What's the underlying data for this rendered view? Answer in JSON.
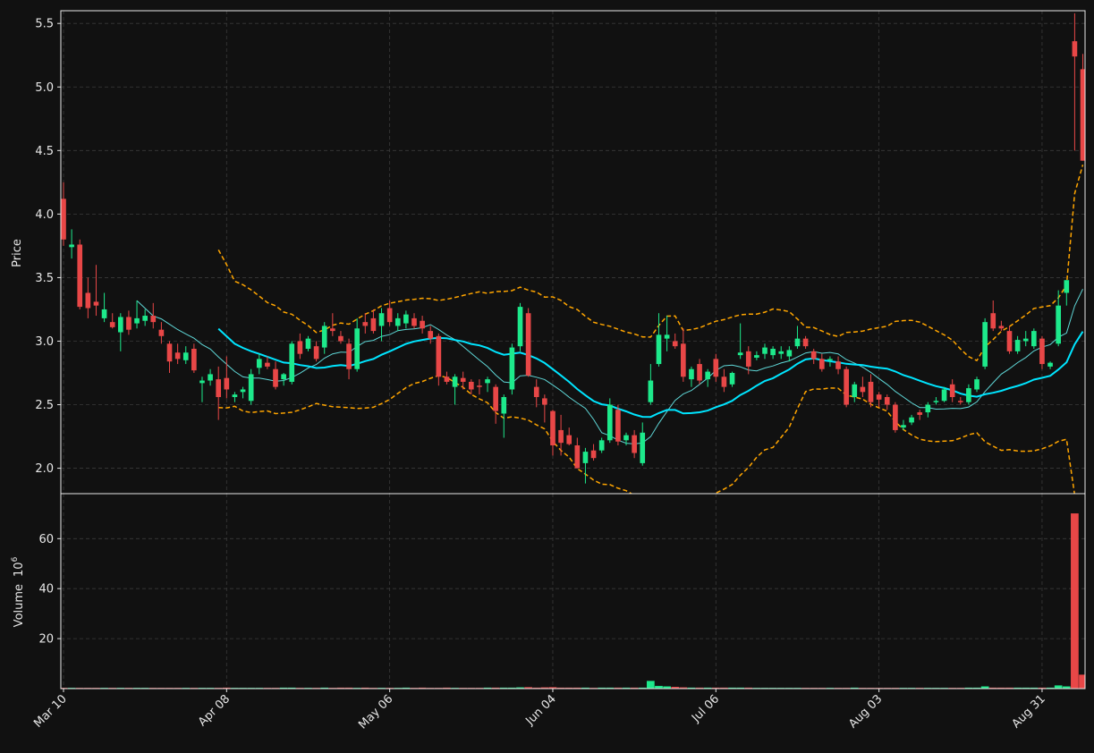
{
  "colors": {
    "background": "#111111",
    "up": "#1de98b",
    "down": "#e84747",
    "ma_fast": "#5fd7d7",
    "ma_slow": "#00e5ff",
    "band": "#ffa500",
    "grid": "#3a3a3a",
    "axis": "#e8e8e8"
  },
  "chart_data": {
    "type": "candlestick",
    "grid": true,
    "price_panel": {
      "ylabel": "Price",
      "ylim": [
        1.8,
        5.6
      ],
      "yticks": [
        "2.0",
        "2.5",
        "3.0",
        "3.5",
        "4.0",
        "4.5",
        "5.0",
        "5.5"
      ]
    },
    "volume_panel": {
      "ylabel": "Volume",
      "yunit": "10",
      "yunit_exp": "6",
      "ylim": [
        0,
        78
      ],
      "yticks": [
        "20",
        "40",
        "60"
      ]
    },
    "xticks": [
      {
        "label": "Mar 10",
        "index": 0
      },
      {
        "label": "Apr 08",
        "index": 20
      },
      {
        "label": "May 06",
        "index": 40
      },
      {
        "label": "Jun 04",
        "index": 60
      },
      {
        "label": "Jul 06",
        "index": 80
      },
      {
        "label": "Aug 03",
        "index": 100
      },
      {
        "label": "Aug 31",
        "index": 120
      }
    ],
    "candles": [
      [
        4.12,
        4.25,
        3.75,
        3.8,
        0.2
      ],
      [
        3.74,
        3.88,
        3.65,
        3.76,
        0.2
      ],
      [
        3.76,
        3.8,
        3.25,
        3.27,
        0.2
      ],
      [
        3.38,
        3.5,
        3.18,
        3.26,
        0.2
      ],
      [
        3.31,
        3.6,
        3.2,
        3.28,
        0.2
      ],
      [
        3.18,
        3.38,
        3.15,
        3.25,
        0.2
      ],
      [
        3.15,
        3.22,
        3.1,
        3.11,
        0.2
      ],
      [
        3.07,
        3.22,
        2.92,
        3.19,
        0.2
      ],
      [
        3.19,
        3.24,
        3.05,
        3.09,
        0.2
      ],
      [
        3.14,
        3.32,
        3.1,
        3.18,
        0.2
      ],
      [
        3.16,
        3.25,
        3.12,
        3.2,
        0.2
      ],
      [
        3.2,
        3.3,
        3.1,
        3.15,
        0.2
      ],
      [
        3.09,
        3.15,
        2.98,
        3.04,
        0.2
      ],
      [
        2.98,
        3.0,
        2.75,
        2.84,
        0.2
      ],
      [
        2.91,
        2.98,
        2.82,
        2.86,
        0.2
      ],
      [
        2.85,
        2.96,
        2.82,
        2.91,
        0.2
      ],
      [
        2.94,
        2.98,
        2.75,
        2.77,
        0.2
      ],
      [
        2.67,
        2.72,
        2.52,
        2.69,
        0.2
      ],
      [
        2.69,
        2.78,
        2.65,
        2.74,
        0.2
      ],
      [
        2.7,
        2.8,
        2.38,
        2.56,
        0.2
      ],
      [
        2.71,
        2.88,
        2.55,
        2.62,
        0.3
      ],
      [
        2.56,
        2.6,
        2.52,
        2.58,
        0.2
      ],
      [
        2.6,
        2.64,
        2.55,
        2.62,
        0.2
      ],
      [
        2.53,
        2.78,
        2.5,
        2.74,
        0.2
      ],
      [
        2.79,
        2.9,
        2.74,
        2.86,
        0.2
      ],
      [
        2.83,
        2.88,
        2.78,
        2.8,
        0.2
      ],
      [
        2.78,
        2.84,
        2.62,
        2.64,
        0.2
      ],
      [
        2.7,
        2.75,
        2.65,
        2.74,
        0.3
      ],
      [
        2.68,
        3.0,
        2.66,
        2.98,
        0.3
      ],
      [
        3.0,
        3.06,
        2.86,
        2.9,
        0.2
      ],
      [
        2.94,
        3.04,
        2.92,
        3.02,
        0.2
      ],
      [
        2.96,
        3.0,
        2.84,
        2.86,
        0.2
      ],
      [
        2.95,
        3.15,
        2.9,
        3.12,
        0.3
      ],
      [
        3.1,
        3.22,
        3.04,
        3.08,
        0.2
      ],
      [
        3.04,
        3.08,
        2.98,
        3.0,
        0.3
      ],
      [
        2.98,
        3.02,
        2.7,
        2.78,
        0.3
      ],
      [
        2.78,
        3.18,
        2.76,
        3.1,
        0.2
      ],
      [
        3.15,
        3.22,
        3.06,
        3.12,
        0.3
      ],
      [
        3.18,
        3.25,
        3.06,
        3.08,
        0.2
      ],
      [
        3.12,
        3.26,
        3.0,
        3.22,
        0.2
      ],
      [
        3.26,
        3.32,
        3.12,
        3.15,
        0.2
      ],
      [
        3.12,
        3.22,
        3.08,
        3.18,
        0.2
      ],
      [
        3.14,
        3.24,
        3.1,
        3.21,
        0.3
      ],
      [
        3.18,
        3.22,
        3.1,
        3.12,
        0.2
      ],
      [
        3.16,
        3.2,
        3.06,
        3.1,
        0.3
      ],
      [
        3.08,
        3.12,
        2.98,
        3.02,
        0.2
      ],
      [
        3.04,
        3.06,
        2.65,
        2.72,
        0.2
      ],
      [
        2.72,
        2.76,
        2.66,
        2.68,
        0.3
      ],
      [
        2.64,
        2.74,
        2.5,
        2.72,
        0.2
      ],
      [
        2.71,
        2.76,
        2.62,
        2.68,
        0.2
      ],
      [
        2.68,
        2.7,
        2.58,
        2.62,
        0.2
      ],
      [
        2.65,
        2.7,
        2.58,
        2.64,
        0.2
      ],
      [
        2.67,
        2.72,
        2.6,
        2.7,
        0.3
      ],
      [
        2.64,
        2.66,
        2.35,
        2.45,
        0.3
      ],
      [
        2.43,
        2.58,
        2.24,
        2.56,
        0.3
      ],
      [
        2.62,
        2.98,
        2.58,
        2.95,
        0.3
      ],
      [
        2.96,
        3.3,
        2.92,
        3.27,
        0.4
      ],
      [
        3.22,
        3.26,
        2.72,
        2.73,
        0.5
      ],
      [
        2.64,
        2.7,
        2.48,
        2.56,
        0.3
      ],
      [
        2.55,
        2.58,
        2.36,
        2.5,
        0.4
      ],
      [
        2.45,
        2.46,
        2.1,
        2.18,
        0.5
      ],
      [
        2.3,
        2.42,
        2.1,
        2.2,
        0.3
      ],
      [
        2.26,
        2.32,
        2.18,
        2.19,
        0.3
      ],
      [
        2.18,
        2.24,
        2.0,
        2.0,
        0.3
      ],
      [
        2.04,
        2.16,
        1.88,
        2.13,
        0.3
      ],
      [
        2.14,
        2.19,
        2.06,
        2.08,
        0.2
      ],
      [
        2.14,
        2.24,
        2.12,
        2.22,
        0.3
      ],
      [
        2.22,
        2.55,
        2.2,
        2.5,
        0.3
      ],
      [
        2.46,
        2.5,
        2.18,
        2.21,
        0.3
      ],
      [
        2.22,
        2.28,
        2.18,
        2.26,
        0.3
      ],
      [
        2.26,
        2.3,
        2.08,
        2.12,
        0.3
      ],
      [
        2.04,
        2.36,
        2.02,
        2.28,
        0.3
      ],
      [
        2.52,
        2.82,
        2.5,
        2.69,
        3.0
      ],
      [
        2.82,
        3.22,
        2.8,
        3.05,
        1.0
      ],
      [
        3.02,
        3.2,
        2.92,
        3.05,
        0.8
      ],
      [
        3.0,
        3.06,
        2.94,
        2.96,
        0.6
      ],
      [
        2.98,
        3.1,
        2.68,
        2.72,
        0.4
      ],
      [
        2.7,
        2.8,
        2.64,
        2.78,
        0.3
      ],
      [
        2.82,
        2.86,
        2.66,
        2.69,
        0.3
      ],
      [
        2.7,
        2.78,
        2.64,
        2.76,
        0.3
      ],
      [
        2.86,
        2.9,
        2.68,
        2.72,
        0.3
      ],
      [
        2.72,
        2.78,
        2.6,
        2.64,
        0.3
      ],
      [
        2.66,
        2.76,
        2.64,
        2.75,
        0.3
      ],
      [
        2.89,
        3.14,
        2.86,
        2.91,
        0.3
      ],
      [
        2.92,
        2.96,
        2.74,
        2.8,
        0.3
      ],
      [
        2.87,
        2.92,
        2.85,
        2.89,
        0.2
      ],
      [
        2.9,
        2.98,
        2.86,
        2.95,
        0.2
      ],
      [
        2.89,
        2.96,
        2.86,
        2.94,
        0.2
      ],
      [
        2.9,
        2.96,
        2.86,
        2.92,
        0.2
      ],
      [
        2.88,
        2.96,
        2.84,
        2.93,
        0.2
      ],
      [
        2.96,
        3.12,
        2.94,
        3.02,
        0.2
      ],
      [
        3.02,
        3.04,
        2.94,
        2.96,
        0.2
      ],
      [
        2.92,
        2.94,
        2.82,
        2.86,
        0.2
      ],
      [
        2.86,
        2.9,
        2.76,
        2.78,
        0.2
      ],
      [
        2.85,
        2.88,
        2.8,
        2.86,
        0.2
      ],
      [
        2.84,
        2.88,
        2.74,
        2.78,
        0.2
      ],
      [
        2.78,
        2.8,
        2.48,
        2.5,
        0.2
      ],
      [
        2.56,
        2.68,
        2.52,
        2.66,
        0.3
      ],
      [
        2.64,
        2.72,
        2.56,
        2.6,
        0.2
      ],
      [
        2.68,
        2.74,
        2.48,
        2.52,
        0.2
      ],
      [
        2.58,
        2.6,
        2.48,
        2.54,
        0.2
      ],
      [
        2.56,
        2.58,
        2.46,
        2.5,
        0.2
      ],
      [
        2.5,
        2.52,
        2.28,
        2.3,
        0.2
      ],
      [
        2.32,
        2.38,
        2.3,
        2.34,
        0.2
      ],
      [
        2.36,
        2.42,
        2.34,
        2.4,
        0.2
      ],
      [
        2.44,
        2.46,
        2.38,
        2.42,
        0.2
      ],
      [
        2.44,
        2.52,
        2.4,
        2.5,
        0.2
      ],
      [
        2.52,
        2.56,
        2.5,
        2.53,
        0.2
      ],
      [
        2.53,
        2.64,
        2.52,
        2.62,
        0.2
      ],
      [
        2.66,
        2.7,
        2.52,
        2.56,
        0.2
      ],
      [
        2.53,
        2.56,
        2.5,
        2.52,
        0.2
      ],
      [
        2.52,
        2.66,
        2.5,
        2.63,
        0.3
      ],
      [
        2.62,
        2.72,
        2.6,
        2.7,
        0.3
      ],
      [
        2.8,
        3.18,
        2.78,
        3.15,
        0.8
      ],
      [
        3.22,
        3.32,
        3.08,
        3.1,
        0.3
      ],
      [
        3.12,
        3.16,
        3.08,
        3.1,
        0.3
      ],
      [
        3.08,
        3.12,
        2.9,
        2.92,
        0.3
      ],
      [
        2.92,
        3.04,
        2.9,
        3.01,
        0.3
      ],
      [
        3.0,
        3.08,
        2.96,
        3.02,
        0.3
      ],
      [
        2.96,
        3.1,
        2.94,
        3.08,
        0.3
      ],
      [
        3.02,
        3.04,
        2.78,
        2.82,
        0.3
      ],
      [
        2.8,
        2.84,
        2.78,
        2.83,
        0.3
      ],
      [
        2.98,
        3.4,
        2.96,
        3.28,
        1.2
      ],
      [
        3.38,
        3.48,
        3.28,
        3.48,
        0.8
      ],
      [
        5.36,
        5.58,
        4.5,
        5.24,
        70.0
      ],
      [
        5.14,
        5.26,
        4.42,
        4.42,
        5.5
      ]
    ]
  }
}
